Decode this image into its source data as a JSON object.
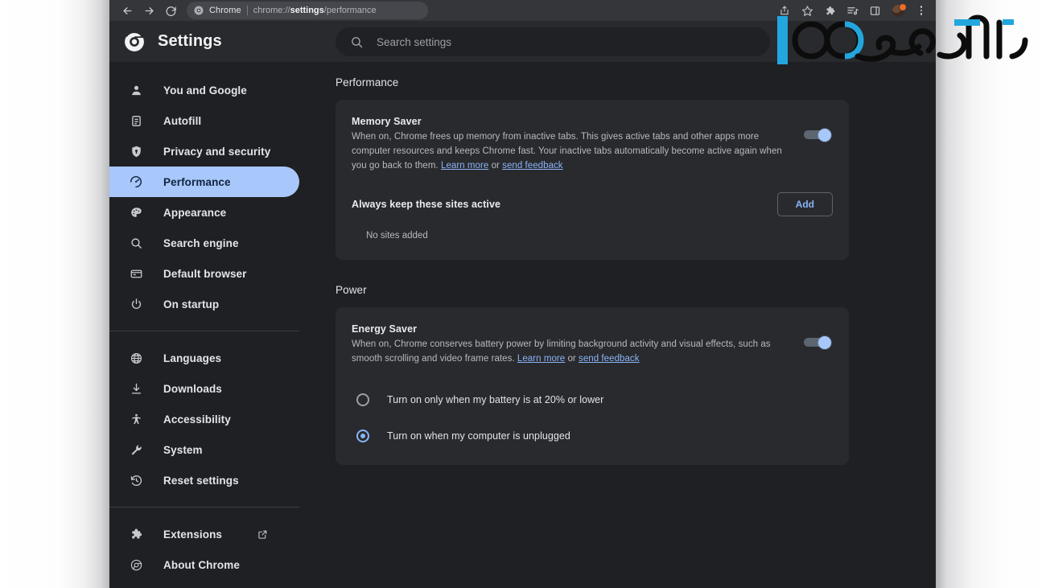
{
  "browser": {
    "nav": {
      "back_icon": "arrow-left-icon",
      "forward_icon": "arrow-right-icon",
      "reload_icon": "reload-icon"
    },
    "omnibox": {
      "favicon": "chrome-favicon",
      "app_label": "Chrome",
      "url_prefix": "chrome://",
      "url_bold": "settings",
      "url_suffix": "/performance",
      "full_url": "chrome://settings/performance"
    },
    "toolbar_icons": [
      "share-icon",
      "bookmark-star-icon",
      "extensions-puzzle-icon",
      "reading-list-icon",
      "side-panel-icon",
      "profile-avatar",
      "three-dot-menu-icon"
    ]
  },
  "header": {
    "logo_icon": "chrome-logo-icon",
    "title": "Settings",
    "search": {
      "icon": "search-icon",
      "placeholder": "Search settings",
      "value": ""
    }
  },
  "sidebar": {
    "items": [
      {
        "label": "You and Google",
        "icon": "person-icon",
        "selected": false
      },
      {
        "label": "Autofill",
        "icon": "clipboard-icon",
        "selected": false
      },
      {
        "label": "Privacy and security",
        "icon": "shield-lock-icon",
        "selected": false
      },
      {
        "label": "Performance",
        "icon": "speedometer-icon",
        "selected": true
      },
      {
        "label": "Appearance",
        "icon": "palette-icon",
        "selected": false
      },
      {
        "label": "Search engine",
        "icon": "magnifier-icon",
        "selected": false
      },
      {
        "label": "Default browser",
        "icon": "browser-window-icon",
        "selected": false
      },
      {
        "label": "On startup",
        "icon": "power-icon",
        "selected": false
      }
    ],
    "items2": [
      {
        "label": "Languages",
        "icon": "globe-icon",
        "selected": false
      },
      {
        "label": "Downloads",
        "icon": "download-icon",
        "selected": false
      },
      {
        "label": "Accessibility",
        "icon": "accessibility-icon",
        "selected": false
      },
      {
        "label": "System",
        "icon": "wrench-icon",
        "selected": false
      },
      {
        "label": "Reset settings",
        "icon": "history-reset-icon",
        "selected": false
      }
    ],
    "items3": [
      {
        "label": "Extensions",
        "icon": "puzzle-icon",
        "external": true,
        "external_icon": "open-in-new-icon"
      },
      {
        "label": "About Chrome",
        "icon": "chrome-circle-icon",
        "external": false
      }
    ]
  },
  "main": {
    "performance_section": {
      "title": "Performance",
      "memory_saver": {
        "title": "Memory Saver",
        "description": "When on, Chrome frees up memory from inactive tabs. This gives active tabs and other apps more computer resources and keeps Chrome fast. Your inactive tabs automatically become active again when you go back to them. ",
        "learn_more": "Learn more",
        "conjunction": " or ",
        "send_feedback": "send feedback",
        "toggle_on": true,
        "toggle_color": "#a8c7fa"
      },
      "sites": {
        "label": "Always keep these sites active",
        "add_label": "Add",
        "empty_text": "No sites added"
      }
    },
    "power_section": {
      "title": "Power",
      "energy_saver": {
        "title": "Energy Saver",
        "description": "When on, Chrome conserves battery power by limiting background activity and visual effects, such as smooth scrolling and video frame rates. ",
        "learn_more": "Learn more",
        "conjunction": " or ",
        "send_feedback": "send feedback",
        "toggle_on": true,
        "toggle_color": "#a8c7fa"
      },
      "radios": [
        {
          "label": "Turn on only when my battery is at 20% or lower",
          "checked": false
        },
        {
          "label": "Turn on when my computer is unplugged",
          "checked": true
        }
      ]
    }
  },
  "watermark": {
    "name": "eqtesad-logo-watermark",
    "text": "اقتصاد",
    "accent_color": "#22a6de",
    "ink_color": "#0b0b0b"
  },
  "colors": {
    "window_bg": "#1f2023",
    "card_bg": "#292a2d",
    "topbar_bg": "#34363a",
    "accent_blue": "#8ab4f8",
    "selected_pill": "#a8c7fa"
  }
}
